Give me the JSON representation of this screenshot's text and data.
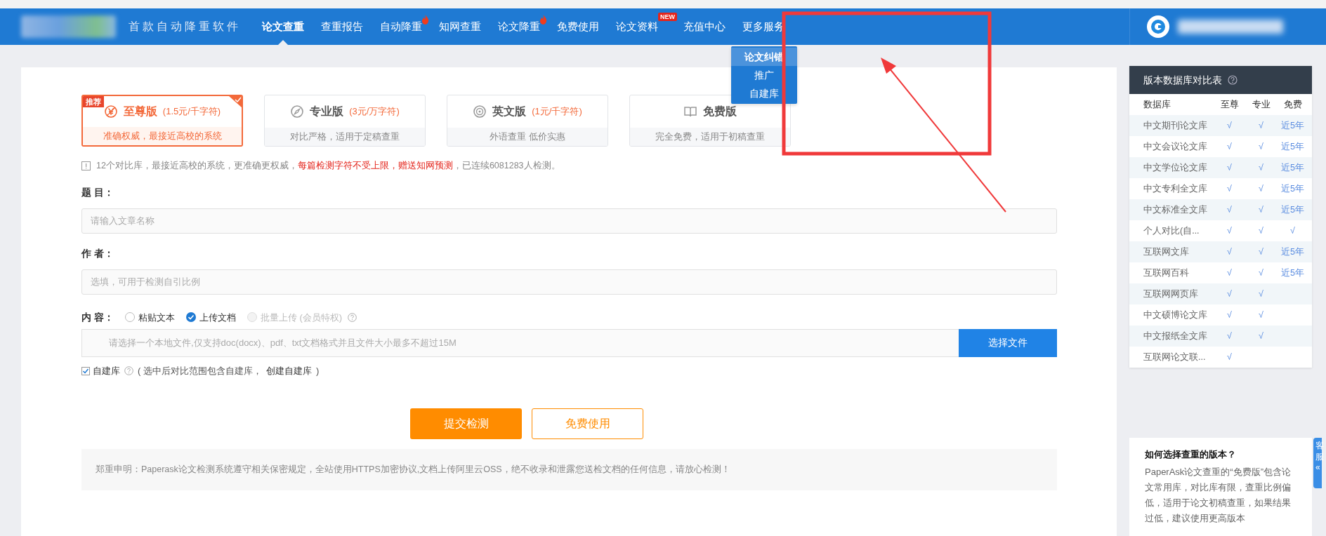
{
  "nav": {
    "tagline": "首款自动降重软件",
    "items": [
      {
        "label": "论文查重",
        "selected": true,
        "hot": false
      },
      {
        "label": "查重报告",
        "selected": false,
        "hot": false
      },
      {
        "label": "自动降重",
        "selected": false,
        "hot": true
      },
      {
        "label": "知网查重",
        "selected": false,
        "hot": false
      },
      {
        "label": "论文降重",
        "selected": false,
        "hot": true
      },
      {
        "label": "免费使用",
        "selected": false,
        "hot": false
      },
      {
        "label": "论文资料",
        "selected": false,
        "hot": false,
        "badge": "NEW"
      },
      {
        "label": "充值中心",
        "selected": false,
        "hot": false
      },
      {
        "label": "更多服务",
        "selected": false,
        "hot": false,
        "dropdown": [
          {
            "label": "论文纠错",
            "selected": true
          },
          {
            "label": "推广",
            "selected": false
          },
          {
            "label": "自建库",
            "selected": false
          }
        ]
      }
    ]
  },
  "versions": [
    {
      "title": "至尊版",
      "price": "(1.5元/千字符)",
      "desc": "准确权威，最接近高校的系统",
      "selected": true,
      "badge": "推荐"
    },
    {
      "title": "专业版",
      "price": "(3元/万字符)",
      "desc": "对比严格，适用于定稿查重",
      "selected": false
    },
    {
      "title": "英文版",
      "price": "(1元/千字符)",
      "desc": "外语查重 低价实惠",
      "selected": false
    },
    {
      "title": "免费版",
      "desc": "完全免费，适用于初稿查重",
      "selected": false
    }
  ],
  "note": [
    {
      "text": "12个对比库，最接近高校的系统，更准确更权威，",
      "highlight": false
    },
    {
      "text": "每篇检测字符不受上限，",
      "highlight": true
    },
    {
      "text": "赠送知网预测",
      "highlight": true
    },
    {
      "text": "，已连续6081283人检测。",
      "highlight": false
    }
  ],
  "form": {
    "title_field": {
      "label": "题 目：",
      "placeholder": "请输入文章名称"
    },
    "author_field": {
      "label": "作 者：",
      "placeholder": "选填，可用于检测自引比例"
    },
    "content": {
      "label": "内 容：",
      "options": [
        {
          "label": "粘贴文本",
          "selected": false,
          "disabled": false
        },
        {
          "label": "上传文档",
          "selected": true,
          "disabled": false
        },
        {
          "label": "批量上传 (会员特权)",
          "selected": false,
          "disabled": true
        }
      ],
      "file_placeholder": "请选择一个本地文件,仅支持doc(docx)、pdf、txt文档格式并且文件大小最多不超过15M",
      "file_button": "选择文件"
    },
    "own_library": {
      "label": "自建库",
      "checked": true,
      "hint": "( 选中后对比范围包含自建库，",
      "link": "创建自建库",
      "hint_end": ")"
    }
  },
  "buttons": {
    "submit": "提交检测",
    "free": "免费使用"
  },
  "disclaimer": "郑重申明：Paperask论文检测系统遵守相关保密规定，全站使用HTTPS加密协议,文档上传阿里云OSS，绝不收录和泄露您送检文档的任何信息，请放心检测！",
  "comparison": {
    "title": "版本数据库对比表",
    "columns": [
      "数据库",
      "至尊",
      "专业",
      "免费"
    ],
    "rows": [
      {
        "cells": [
          "中文期刊论文库",
          "√",
          "√",
          "近5年"
        ]
      },
      {
        "cells": [
          "中文会议论文库",
          "√",
          "√",
          "近5年"
        ]
      },
      {
        "cells": [
          "中文学位论文库",
          "√",
          "√",
          "近5年"
        ]
      },
      {
        "cells": [
          "中文专利全文库",
          "√",
          "√",
          "近5年"
        ]
      },
      {
        "cells": [
          "中文标准全文库",
          "√",
          "√",
          "近5年"
        ]
      },
      {
        "cells": [
          "个人对比(自...",
          "√",
          "√",
          "√"
        ]
      },
      {
        "cells": [
          "互联网文库",
          "√",
          "√",
          "近5年"
        ]
      },
      {
        "cells": [
          "互联网百科",
          "√",
          "√",
          "近5年"
        ]
      },
      {
        "cells": [
          "互联网网页库",
          "√",
          "√"
        ]
      },
      {
        "cells": [
          "中文硕博论文库",
          "√",
          "√"
        ]
      },
      {
        "cells": [
          "中文报纸全文库",
          "√",
          "√"
        ]
      },
      {
        "cells": [
          "互联网论文联...",
          "√"
        ]
      }
    ]
  },
  "help": {
    "title": "如何选择查重的版本？",
    "body": "PaperAsk论文查重的“免费版”包含论文常用库，对比库有限，查重比例偏低，适用于论文初稿查重，如果结果过低，建议使用更高版本"
  },
  "side_tab": {
    "text": "客服",
    "symbol": "«"
  }
}
